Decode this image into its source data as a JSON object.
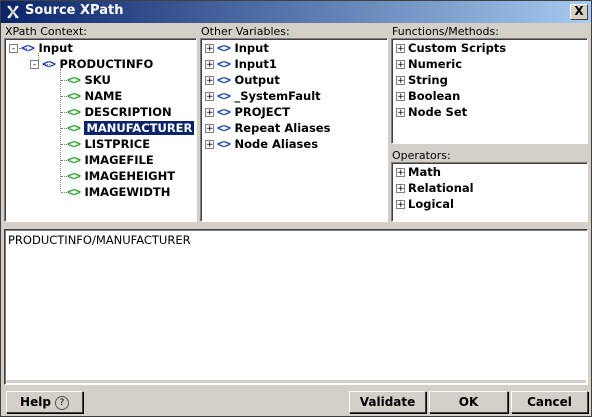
{
  "window": {
    "title": "Source XPath",
    "close_label": "X"
  },
  "xpath_context": {
    "label": "XPath Context:",
    "root": "Input",
    "parent": "PRODUCTINFO",
    "children": [
      "SKU",
      "NAME",
      "DESCRIPTION",
      "MANUFACTURER",
      "LISTPRICE",
      "IMAGEFILE",
      "IMAGEHEIGHT",
      "IMAGEWIDTH"
    ],
    "selected": "MANUFACTURER"
  },
  "other_variables": {
    "label": "Other Variables:",
    "items": [
      "Input",
      "Input1",
      "Output",
      "_SystemFault",
      "PROJECT",
      "Repeat Aliases",
      "Node Aliases"
    ]
  },
  "functions": {
    "label": "Functions/Methods:",
    "items": [
      "Custom Scripts",
      "Numeric",
      "String",
      "Boolean",
      "Node Set"
    ]
  },
  "operators": {
    "label": "Operators:",
    "items": [
      "Math",
      "Relational",
      "Logical"
    ]
  },
  "editor": {
    "value": "PRODUCTINFO/MANUFACTURER"
  },
  "buttons": {
    "help": "Help",
    "help_icon": "?",
    "validate": "Validate",
    "ok": "OK",
    "cancel": "Cancel"
  },
  "icons": {
    "node_glyph": "<>",
    "expand": "+",
    "collapse": "-"
  },
  "colors": {
    "title_start": "#0a246a",
    "title_end": "#a6caf0",
    "node_blue": "#1a3dbf",
    "node_green": "#21a021",
    "selection": "#0a246a"
  }
}
